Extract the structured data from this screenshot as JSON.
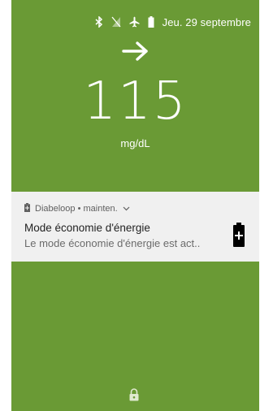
{
  "status_bar": {
    "date_text": "Jeu. 29 septembre",
    "icons": [
      "bluetooth-icon",
      "no-signal-icon",
      "airplane-mode-icon",
      "battery-icon"
    ]
  },
  "glucose": {
    "trend_icon": "arrow-right-icon",
    "value": "115",
    "unit": "mg/dL"
  },
  "notification": {
    "app_name": "Diabeloop • mainten.",
    "app_icon": "battery-saver-icon",
    "expand_icon": "chevron-down-icon",
    "title": "Mode économie d'énergie",
    "text": "Le mode économie d'énergie est act..",
    "large_icon": "battery-saver-icon"
  },
  "lockscreen": {
    "lock_icon": "lock-icon"
  },
  "colors": {
    "background": "#6a9a35",
    "notification_bg": "#f0f0f0",
    "text_primary": "#ffffff"
  }
}
